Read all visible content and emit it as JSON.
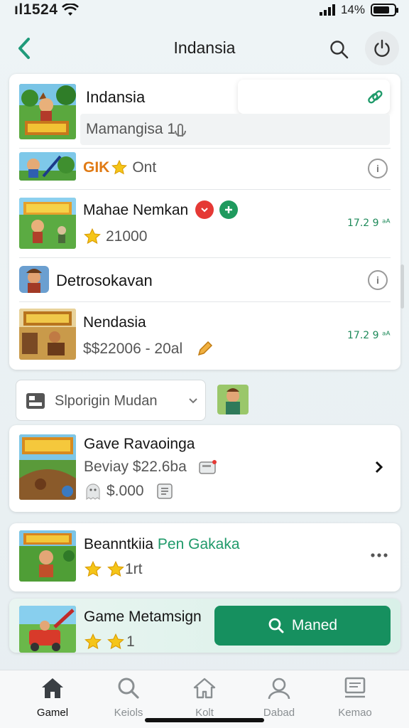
{
  "status_bar": {
    "time": "ıl1524",
    "battery": "14%"
  },
  "header": {
    "title": "Indansia"
  },
  "popup": {
    "title": "Indansia",
    "input_text": "Mamangisa 1"
  },
  "list": [
    {
      "title": "",
      "badge": "GIK",
      "sub": "Ont"
    },
    {
      "title": "Mahae Nemkan",
      "sub": "21000",
      "value": "17.2 9 ᵃᴬ"
    },
    {
      "title": "Detrosokavan"
    },
    {
      "title": "Nendasia",
      "sub": "$$22006 - 20al",
      "value": "17.2 9 ᵃᴬ"
    }
  ],
  "filter": {
    "label": "Slporigin Mudan"
  },
  "cards": [
    {
      "title": "Gave Ravaoinga",
      "sub1": "Beviay $22.6ba",
      "sub2": "$.000"
    },
    {
      "title": "Beanntkiia",
      "title_accent": "Pen Gakaka",
      "sub": "1rt"
    },
    {
      "title": "Game Metamsign",
      "sub": "1",
      "button": "Maned"
    }
  ],
  "nav": [
    {
      "label": "Gamel",
      "icon": "home-icon"
    },
    {
      "label": "Keiols",
      "icon": "search-icon"
    },
    {
      "label": "Kolt",
      "icon": "house-outline-icon"
    },
    {
      "label": "Dabad",
      "icon": "user-icon"
    },
    {
      "label": "Kemao",
      "icon": "screen-icon"
    }
  ],
  "colors": {
    "accent": "#1f9a6a",
    "button": "#16905f",
    "red_badge": "#e53935"
  }
}
